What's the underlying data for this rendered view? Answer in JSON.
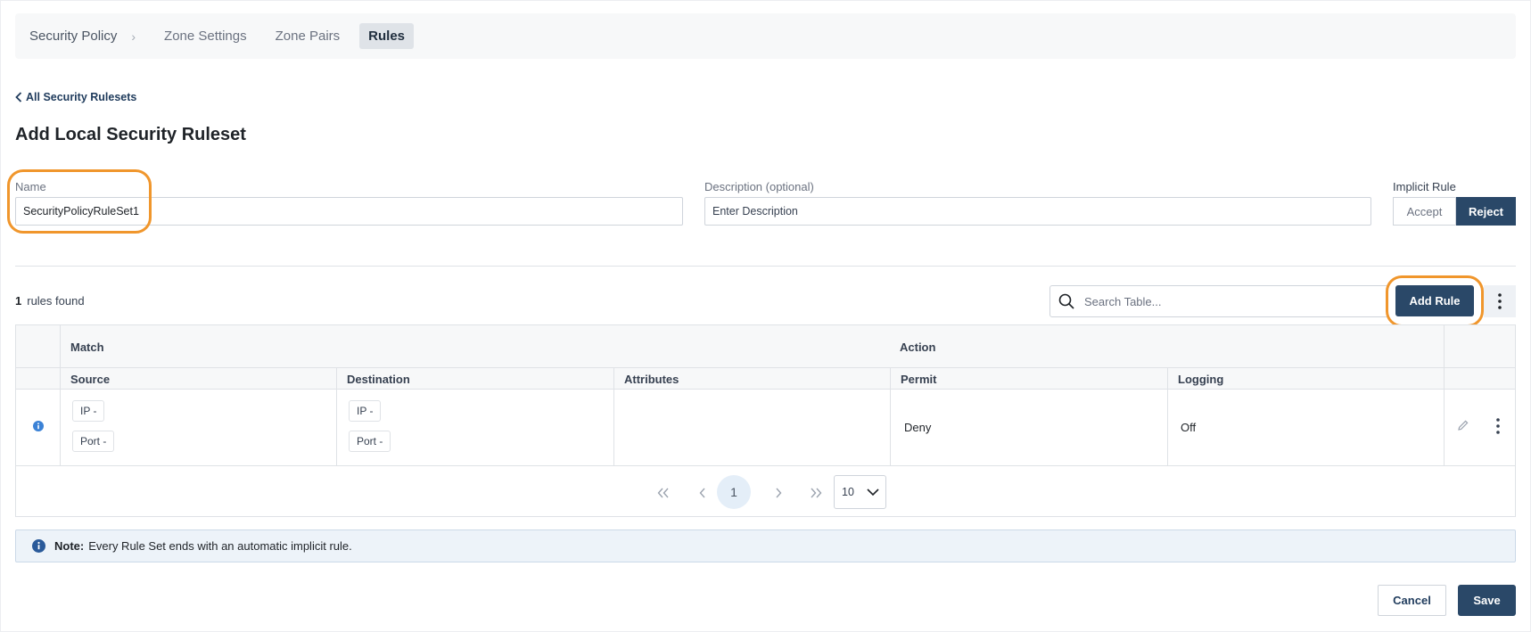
{
  "breadcrumb": {
    "items": [
      "Security Policy",
      "Zone Settings",
      "Zone Pairs",
      "Rules"
    ],
    "separator": "›"
  },
  "back_link": "All Security Rulesets",
  "page_title": "Add Local Security Ruleset",
  "form": {
    "name_label": "Name",
    "name_value": "SecurityPolicyRuleSet1",
    "description_label": "Description (optional)",
    "description_placeholder": "Enter Description",
    "implicit_rule_label": "Implicit Rule",
    "implicit_options": [
      "Accept",
      "Reject"
    ],
    "implicit_selected": "Reject"
  },
  "table_toolbar": {
    "count": "1",
    "count_suffix": "rules found",
    "search_placeholder": "Search Table...",
    "add_rule_label": "Add Rule"
  },
  "table": {
    "group_headers": {
      "match": "Match",
      "action": "Action"
    },
    "columns": [
      "Source",
      "Destination",
      "Attributes",
      "Permit",
      "Logging"
    ],
    "rows": [
      {
        "source": {
          "ip": "IP  -",
          "port": "Port  -"
        },
        "destination": {
          "ip": "IP  -",
          "port": "Port  -"
        },
        "attributes": "",
        "permit": "Deny",
        "logging": "Off"
      }
    ]
  },
  "pagination": {
    "current_page": "1",
    "page_size": "10"
  },
  "note": {
    "label": "Note:",
    "text": "Every Rule Set ends with an automatic implicit rule."
  },
  "footer": {
    "cancel_label": "Cancel",
    "save_label": "Save"
  },
  "colors": {
    "primary": "#2a4868",
    "highlight": "#f0962c",
    "info_icon": "#3b82d6",
    "note_bg": "#edf3f9"
  },
  "icons": [
    "chevron-left-icon",
    "search-icon",
    "kebab-menu-icon",
    "info-icon",
    "edit-pencil-icon",
    "first-page-icon",
    "prev-page-icon",
    "next-page-icon",
    "last-page-icon",
    "chevron-down-icon"
  ]
}
